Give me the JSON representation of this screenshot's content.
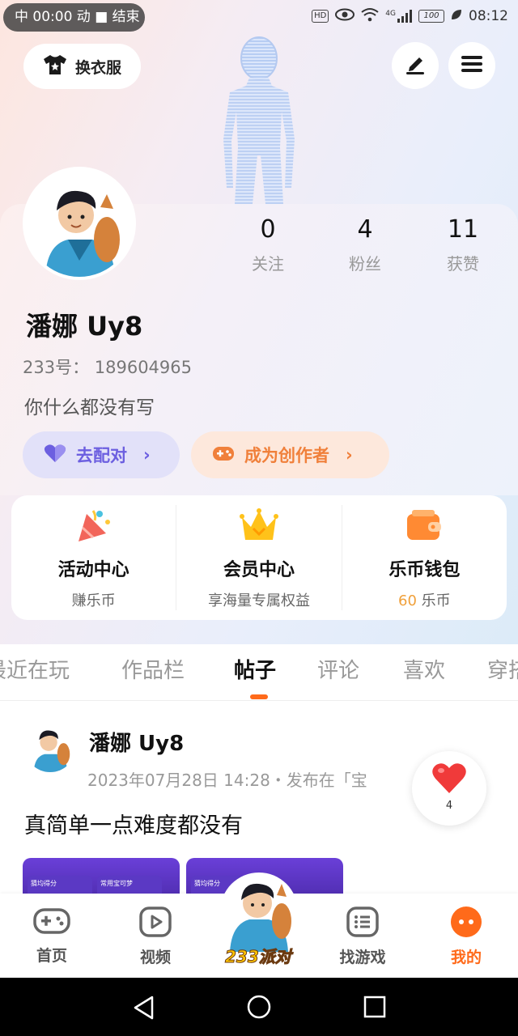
{
  "status_bar": {
    "recording_text": "中 00:00 动 ■ 结束",
    "network": "HD",
    "signal": "4G",
    "battery": "100",
    "time": "08:12"
  },
  "header": {
    "outfit_label": "换衣服"
  },
  "profile": {
    "stats": [
      {
        "value": "0",
        "label": "关注"
      },
      {
        "value": "4",
        "label": "粉丝"
      },
      {
        "value": "11",
        "label": "获赞"
      }
    ],
    "username": "潘娜 Uy8",
    "uid_text": "233号： 189604965",
    "bio": "你什么都没有写",
    "match_label": "去配对",
    "creator_label": "成为创作者"
  },
  "services": [
    {
      "title": "活动中心",
      "subtitle": "赚乐币",
      "icon": "party-popper-icon"
    },
    {
      "title": "会员中心",
      "subtitle": "享海量专属权益",
      "icon": "crown-icon"
    },
    {
      "title": "乐币钱包",
      "amount": "60",
      "unit": "乐币",
      "icon": "wallet-icon"
    }
  ],
  "tabs": [
    "最近在玩",
    "作品栏",
    "帖子",
    "评论",
    "喜欢",
    "穿搭"
  ],
  "active_tab": "帖子",
  "post": {
    "author": "潘娜 Uy8",
    "meta": "2023年07月28日 14:28・发布在「宝",
    "text": "真简单一点难度都没有",
    "thumb1_label": "猜均得分",
    "thumb1_label2": "常用宝可梦",
    "thumb2_label": "猜均得分",
    "likes": "4"
  },
  "bottom_nav": [
    {
      "label": "首页",
      "icon": "gamepad-icon"
    },
    {
      "label": "视频",
      "icon": "play-icon"
    },
    {
      "label": "233派对",
      "icon": "party-logo"
    },
    {
      "label": "找游戏",
      "icon": "list-icon"
    },
    {
      "label": "我的",
      "icon": "profile-face-icon"
    }
  ],
  "colors": {
    "accent": "#ff6a1a",
    "match": "#6c5fe0",
    "creator": "#f0803b"
  }
}
